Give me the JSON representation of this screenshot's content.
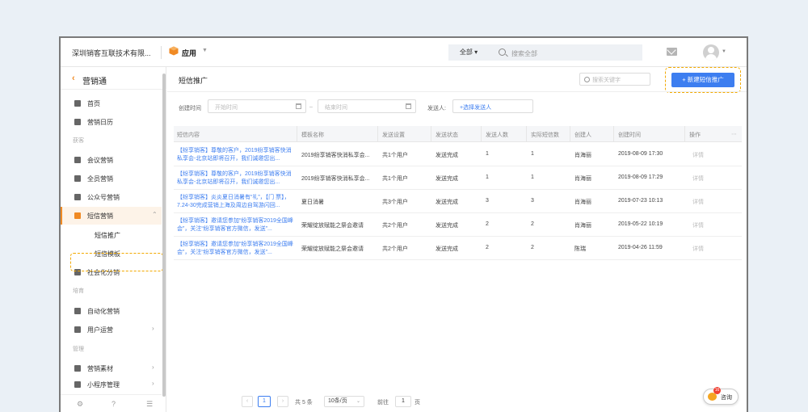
{
  "header": {
    "company": "深圳销客互联技术有限...",
    "app_label": "应用",
    "scope": "全部",
    "search_placeholder": "搜索全部"
  },
  "sidebar": {
    "title": "营销通",
    "items": [
      {
        "label": "首页"
      },
      {
        "label": "营销日历"
      }
    ],
    "group1": "获客",
    "group1_items": [
      {
        "label": "会议营销"
      },
      {
        "label": "全员营销"
      },
      {
        "label": "公众号营销"
      },
      {
        "label": "短信营销"
      }
    ],
    "sms_sub": [
      {
        "label": "短信推广"
      },
      {
        "label": "短信模板"
      }
    ],
    "social": "社会化分销",
    "group2": "培育",
    "group2_items": [
      {
        "label": "自动化营销"
      },
      {
        "label": "用户运营"
      }
    ],
    "group3": "管理",
    "group3_items": [
      {
        "label": "营销素材"
      },
      {
        "label": "小程序管理"
      }
    ]
  },
  "main": {
    "title": "短信推广",
    "keyword_placeholder": "搜索关键字",
    "new_button": "+ 新建短信推广",
    "filter": {
      "time_label": "创建时间",
      "start_placeholder": "开始时间",
      "end_placeholder": "结束时间",
      "sender_label": "发送人:",
      "sender_link": "+选择发送人"
    },
    "columns": [
      "短信内容",
      "模板名称",
      "发送设置",
      "发送状态",
      "发送人数",
      "实际短信数",
      "创建人",
      "创建时间",
      "操作"
    ],
    "rows": [
      {
        "content": "【纷享销客】尊敬的客户，2019纷享销客快消私享会-北京站即将召开，我们诚邀您出...",
        "template": "2019纷享销客快消私享会...",
        "setting": "共1个用户",
        "status": "发送完成",
        "count": "1",
        "actual": "1",
        "creator": "肖海丽",
        "time": "2019-08-09 17:30",
        "op": "详情"
      },
      {
        "content": "【纷享销客】尊敬的客户，2019纷享销客快消私享会-北京站即将召开，我们诚邀您出...",
        "template": "2019纷享销客快消私享会...",
        "setting": "共1个用户",
        "status": "发送完成",
        "count": "1",
        "actual": "1",
        "creator": "肖海丽",
        "time": "2019-08-09 17:29",
        "op": "详情"
      },
      {
        "content": "【纷享销客】炎炎夏日消暑有“礼”，【门 票】，7.24-30完成营销上海及周边自驾游闪回...",
        "template": "夏日消暑",
        "setting": "共3个用户",
        "status": "发送完成",
        "count": "3",
        "actual": "3",
        "creator": "肖海丽",
        "time": "2019-07-23 10:13",
        "op": "详情"
      },
      {
        "content": "【纷享销客】邀请您参加“纷享销客2019全国峰会”，关注“纷享销客官方微信，发送”...",
        "template": "荣耀绽放赋能之祭会邀请",
        "setting": "共2个用户",
        "status": "发送完成",
        "count": "2",
        "actual": "2",
        "creator": "肖海丽",
        "time": "2019-05-22 10:19",
        "op": "详情"
      },
      {
        "content": "【纷享销客】邀请您参加“纷享销客2019全国峰会”，关注“纷享销客官方微信，发送”...",
        "template": "荣耀绽放赋能之祭会邀请",
        "setting": "共2个用户",
        "status": "发送完成",
        "count": "2",
        "actual": "2",
        "creator": "陈瑞",
        "time": "2019-04-26 11:59",
        "op": "详情"
      }
    ],
    "pager": {
      "current": "1",
      "total": "共 5 条",
      "size": "10条/页",
      "goto": "前往",
      "goto_value": "1",
      "page_unit": "页"
    }
  },
  "consult": {
    "label": "咨询",
    "badge": "16"
  },
  "colors": {
    "accent": "#f08a24",
    "primary": "#3d7ef0",
    "highlight": "#f2a900"
  }
}
